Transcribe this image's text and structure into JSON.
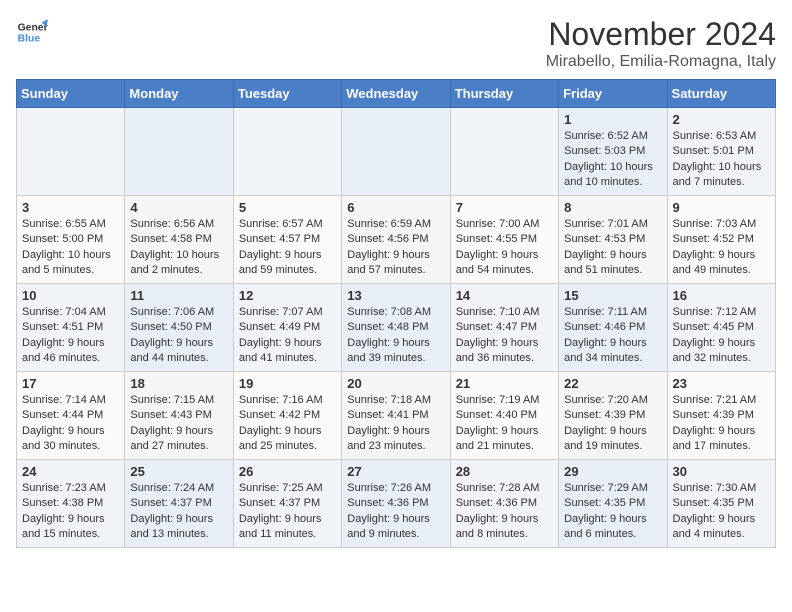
{
  "header": {
    "logo_general": "General",
    "logo_blue": "Blue",
    "month_title": "November 2024",
    "location": "Mirabello, Emilia-Romagna, Italy"
  },
  "weekdays": [
    "Sunday",
    "Monday",
    "Tuesday",
    "Wednesday",
    "Thursday",
    "Friday",
    "Saturday"
  ],
  "weeks": [
    [
      {
        "day": "",
        "info": ""
      },
      {
        "day": "",
        "info": ""
      },
      {
        "day": "",
        "info": ""
      },
      {
        "day": "",
        "info": ""
      },
      {
        "day": "",
        "info": ""
      },
      {
        "day": "1",
        "info": "Sunrise: 6:52 AM\nSunset: 5:03 PM\nDaylight: 10 hours and 10 minutes."
      },
      {
        "day": "2",
        "info": "Sunrise: 6:53 AM\nSunset: 5:01 PM\nDaylight: 10 hours and 7 minutes."
      }
    ],
    [
      {
        "day": "3",
        "info": "Sunrise: 6:55 AM\nSunset: 5:00 PM\nDaylight: 10 hours and 5 minutes."
      },
      {
        "day": "4",
        "info": "Sunrise: 6:56 AM\nSunset: 4:58 PM\nDaylight: 10 hours and 2 minutes."
      },
      {
        "day": "5",
        "info": "Sunrise: 6:57 AM\nSunset: 4:57 PM\nDaylight: 9 hours and 59 minutes."
      },
      {
        "day": "6",
        "info": "Sunrise: 6:59 AM\nSunset: 4:56 PM\nDaylight: 9 hours and 57 minutes."
      },
      {
        "day": "7",
        "info": "Sunrise: 7:00 AM\nSunset: 4:55 PM\nDaylight: 9 hours and 54 minutes."
      },
      {
        "day": "8",
        "info": "Sunrise: 7:01 AM\nSunset: 4:53 PM\nDaylight: 9 hours and 51 minutes."
      },
      {
        "day": "9",
        "info": "Sunrise: 7:03 AM\nSunset: 4:52 PM\nDaylight: 9 hours and 49 minutes."
      }
    ],
    [
      {
        "day": "10",
        "info": "Sunrise: 7:04 AM\nSunset: 4:51 PM\nDaylight: 9 hours and 46 minutes."
      },
      {
        "day": "11",
        "info": "Sunrise: 7:06 AM\nSunset: 4:50 PM\nDaylight: 9 hours and 44 minutes."
      },
      {
        "day": "12",
        "info": "Sunrise: 7:07 AM\nSunset: 4:49 PM\nDaylight: 9 hours and 41 minutes."
      },
      {
        "day": "13",
        "info": "Sunrise: 7:08 AM\nSunset: 4:48 PM\nDaylight: 9 hours and 39 minutes."
      },
      {
        "day": "14",
        "info": "Sunrise: 7:10 AM\nSunset: 4:47 PM\nDaylight: 9 hours and 36 minutes."
      },
      {
        "day": "15",
        "info": "Sunrise: 7:11 AM\nSunset: 4:46 PM\nDaylight: 9 hours and 34 minutes."
      },
      {
        "day": "16",
        "info": "Sunrise: 7:12 AM\nSunset: 4:45 PM\nDaylight: 9 hours and 32 minutes."
      }
    ],
    [
      {
        "day": "17",
        "info": "Sunrise: 7:14 AM\nSunset: 4:44 PM\nDaylight: 9 hours and 30 minutes."
      },
      {
        "day": "18",
        "info": "Sunrise: 7:15 AM\nSunset: 4:43 PM\nDaylight: 9 hours and 27 minutes."
      },
      {
        "day": "19",
        "info": "Sunrise: 7:16 AM\nSunset: 4:42 PM\nDaylight: 9 hours and 25 minutes."
      },
      {
        "day": "20",
        "info": "Sunrise: 7:18 AM\nSunset: 4:41 PM\nDaylight: 9 hours and 23 minutes."
      },
      {
        "day": "21",
        "info": "Sunrise: 7:19 AM\nSunset: 4:40 PM\nDaylight: 9 hours and 21 minutes."
      },
      {
        "day": "22",
        "info": "Sunrise: 7:20 AM\nSunset: 4:39 PM\nDaylight: 9 hours and 19 minutes."
      },
      {
        "day": "23",
        "info": "Sunrise: 7:21 AM\nSunset: 4:39 PM\nDaylight: 9 hours and 17 minutes."
      }
    ],
    [
      {
        "day": "24",
        "info": "Sunrise: 7:23 AM\nSunset: 4:38 PM\nDaylight: 9 hours and 15 minutes."
      },
      {
        "day": "25",
        "info": "Sunrise: 7:24 AM\nSunset: 4:37 PM\nDaylight: 9 hours and 13 minutes."
      },
      {
        "day": "26",
        "info": "Sunrise: 7:25 AM\nSunset: 4:37 PM\nDaylight: 9 hours and 11 minutes."
      },
      {
        "day": "27",
        "info": "Sunrise: 7:26 AM\nSunset: 4:36 PM\nDaylight: 9 hours and 9 minutes."
      },
      {
        "day": "28",
        "info": "Sunrise: 7:28 AM\nSunset: 4:36 PM\nDaylight: 9 hours and 8 minutes."
      },
      {
        "day": "29",
        "info": "Sunrise: 7:29 AM\nSunset: 4:35 PM\nDaylight: 9 hours and 6 minutes."
      },
      {
        "day": "30",
        "info": "Sunrise: 7:30 AM\nSunset: 4:35 PM\nDaylight: 9 hours and 4 minutes."
      }
    ]
  ]
}
